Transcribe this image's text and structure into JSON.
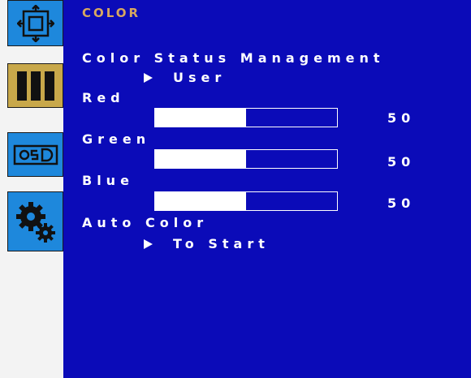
{
  "sidebar": {
    "items": [
      {
        "icon": "picture-icon",
        "active": false
      },
      {
        "icon": "color-bars-icon",
        "active": true
      },
      {
        "icon": "osd-icon",
        "active": false
      },
      {
        "icon": "gears-icon",
        "active": false
      }
    ]
  },
  "menu": {
    "title": "COLOR",
    "color_status": {
      "label": "Color Status Management",
      "value": "User"
    },
    "red": {
      "label": "Red",
      "value": "50",
      "level": 0.5
    },
    "green": {
      "label": "Green",
      "value": "50",
      "level": 0.5
    },
    "blue": {
      "label": "Blue",
      "value": "50",
      "level": 0.5
    },
    "auto_color": {
      "label": "Auto Color",
      "value": "To Start"
    }
  },
  "colors": {
    "background": "#0b0bb8",
    "sidebar_blue": "#1e88dc",
    "sidebar_active": "#c8a84a",
    "title": "#d8a860",
    "text": "#ffffff"
  }
}
